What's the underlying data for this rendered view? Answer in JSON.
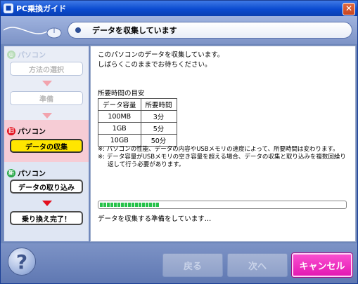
{
  "window": {
    "title": "PC乗換ガイド",
    "close_label": "✕"
  },
  "header": {
    "step_title": "データを収集しています"
  },
  "sidebar": {
    "top_section_label": "パソコン",
    "top_items": [
      {
        "label": "方法の選択"
      },
      {
        "label": "準備"
      }
    ],
    "old_section": {
      "mark": "旧",
      "label": "パソコン",
      "item": "データの収集"
    },
    "new_section": {
      "mark": "新",
      "label": "パソコン",
      "items": [
        {
          "label": "データの取り込み"
        },
        {
          "label": "乗り換え完了！"
        }
      ]
    }
  },
  "main": {
    "intro_line1": "このパソコンのデータを収集しています。",
    "intro_line2": "しばらくこのままでお待ちください。",
    "guide_title": "所要時間の目安",
    "table": {
      "headers": [
        "データ容量",
        "所要時間"
      ],
      "rows": [
        [
          "100MB",
          "3分"
        ],
        [
          "1GB",
          "5分"
        ],
        [
          "10GB",
          "50分"
        ]
      ]
    },
    "notes": [
      "※: パソコンの性能、データの内容やUSBメモリの速度によって、所要時間は変わります。",
      "※: データ容量がUSBメモリの空き容量を超える場合、データの収集と取り込みを複数回繰り返して行う必要があります。"
    ],
    "progress": 0.24,
    "status_text": "データを収集する準備をしています…"
  },
  "footer": {
    "help_label": "?",
    "back_label": "戻る",
    "next_label": "次へ",
    "cancel_label": "キャンセル"
  },
  "colors": {
    "accent_pink": "#e419b3",
    "progress_green": "#27c24a",
    "active_yellow": "#ffe600",
    "arrow_red": "#e3101e"
  }
}
